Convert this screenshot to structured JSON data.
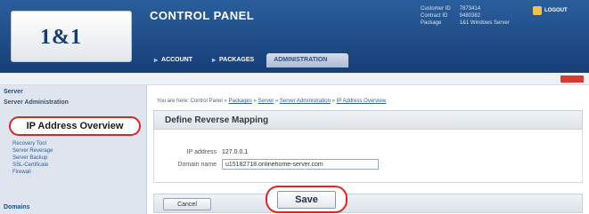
{
  "header": {
    "logo": "1&1",
    "title": "CONTROL PANEL",
    "customer_info": [
      {
        "key": "Customer ID",
        "value": "7873414"
      },
      {
        "key": "Contract ID",
        "value": "9480382"
      },
      {
        "key": "Package",
        "value": "1&1 Windows Server"
      }
    ],
    "logout_label": "LOGOUT",
    "nav": [
      {
        "label": "ACCOUNT"
      },
      {
        "label": "PACKAGES"
      },
      {
        "label": "ADMINISTRATION"
      }
    ]
  },
  "sidebar": {
    "section": "Server",
    "subsection": "Server Administration",
    "active_item": "IP Address Overview",
    "items": [
      "Recovery Tool",
      "Server Reverage",
      "Server Backup",
      "SSL-Certificate",
      "Firewall"
    ],
    "bottom_section": "Domains"
  },
  "breadcrumb": {
    "prefix": "You are here: Control Panel »",
    "links": [
      "Packages",
      "Server",
      "Server Administration",
      "IP Address Overview"
    ]
  },
  "panel": {
    "title": "Define Reverse Mapping",
    "ip_label": "IP address",
    "ip_value": "127.0.0.1",
    "domain_label": "Domain name",
    "domain_value": "u15182718.onlinehome-server.com"
  },
  "buttons": {
    "cancel": "Cancel",
    "save": "Save"
  },
  "colors": {
    "header_blue": "#1f4a85",
    "highlight_red": "#e02424",
    "link_blue": "#2e5d98"
  }
}
